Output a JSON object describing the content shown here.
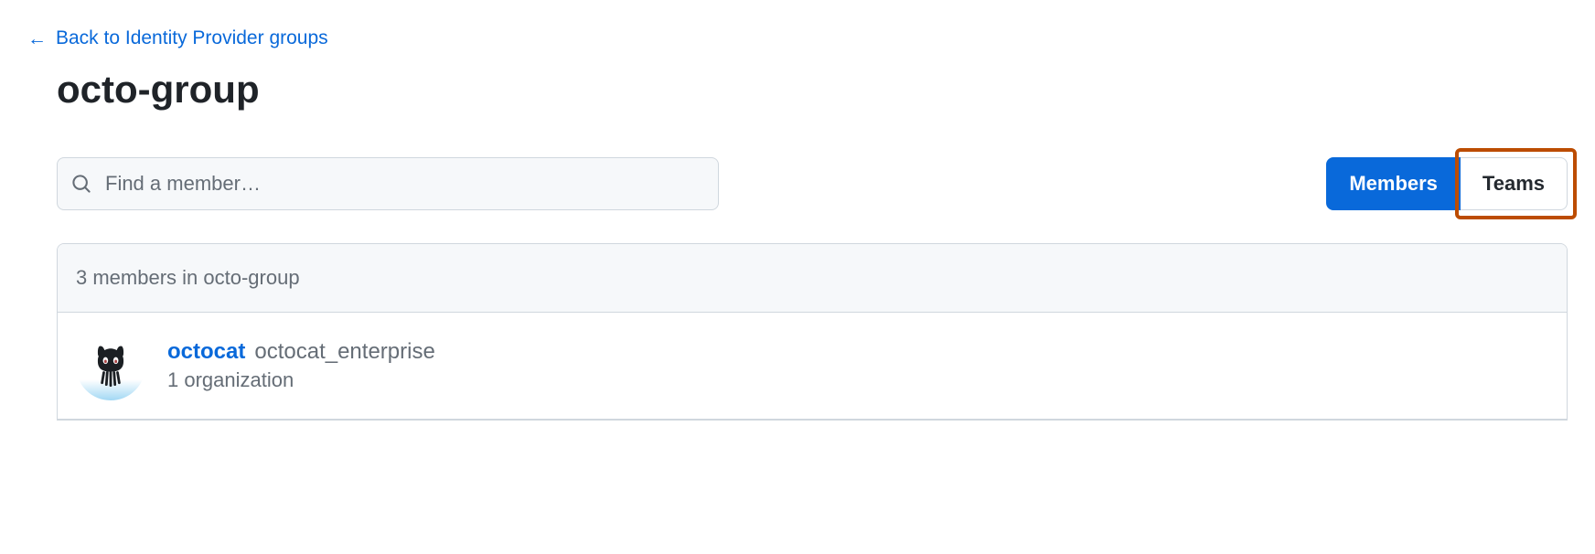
{
  "back_link": {
    "label": "Back to Identity Provider groups"
  },
  "page_title": "octo-group",
  "search": {
    "placeholder": "Find a member…"
  },
  "tabs": {
    "members": "Members",
    "teams": "Teams"
  },
  "list_header": "3 members in octo-group",
  "members": [
    {
      "username": "octocat",
      "fullname": "octocat_enterprise",
      "meta": "1 organization"
    }
  ]
}
